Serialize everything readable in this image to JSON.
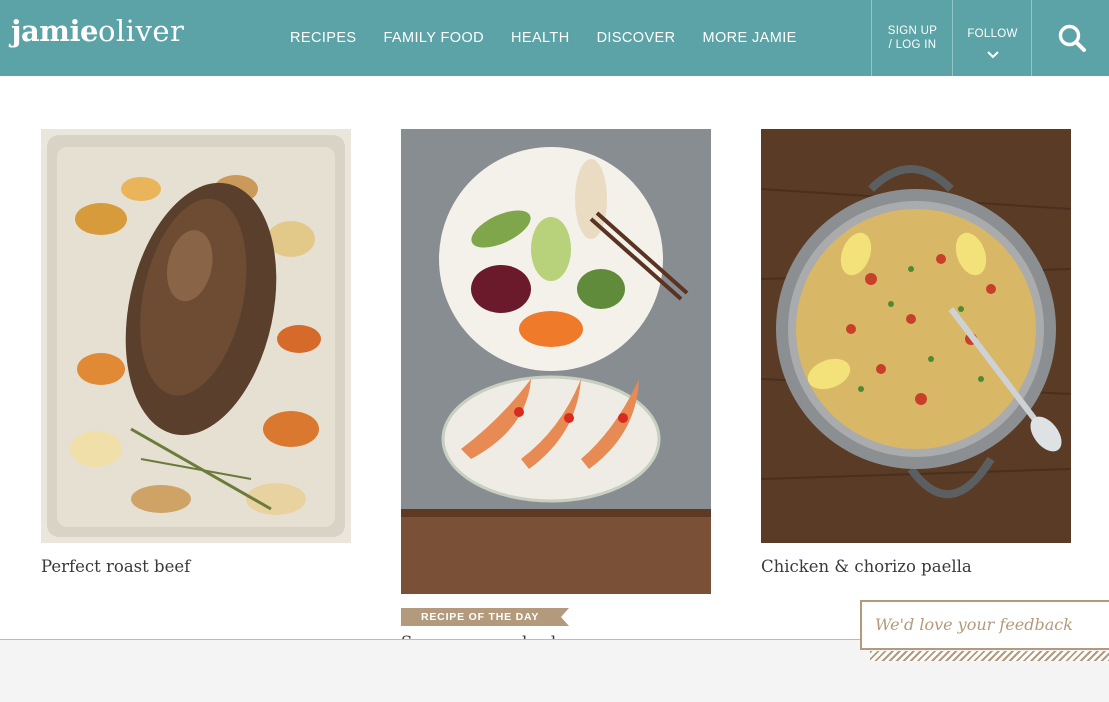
{
  "header": {
    "logo": {
      "part1": "jamie",
      "part2": "oliver"
    },
    "nav": [
      "RECIPES",
      "FAMILY FOOD",
      "HEALTH",
      "DISCOVER",
      "MORE JAMIE"
    ],
    "signup": {
      "line1": "SIGN UP",
      "line2": "/ LOG IN"
    },
    "follow_label": "FOLLOW",
    "search_icon": "search-icon",
    "background": "#5ba3a7"
  },
  "cards": [
    {
      "title": "Perfect roast beef"
    },
    {
      "title": "Sesame seared salmon",
      "badge": "RECIPE OF THE DAY"
    },
    {
      "title": "Chicken & chorizo paella"
    }
  ],
  "feedback": {
    "label": "We'd love your feedback"
  },
  "colors": {
    "accent": "#b49a7c",
    "text": "#3a3a3a"
  }
}
